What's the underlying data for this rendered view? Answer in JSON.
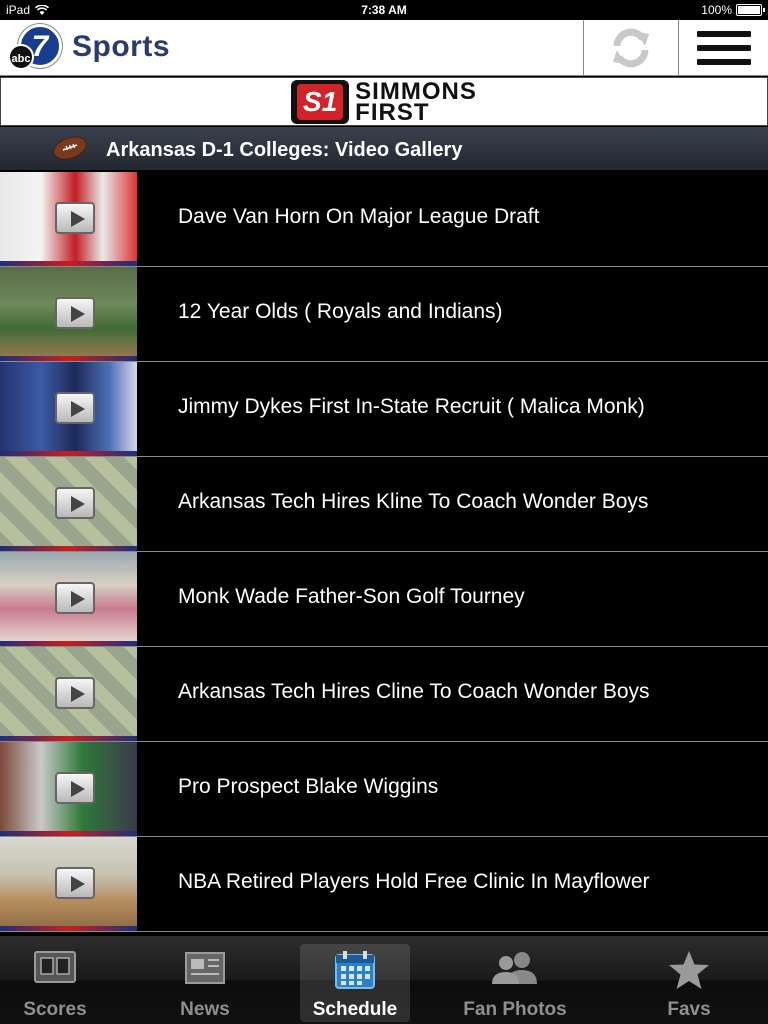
{
  "status_bar": {
    "device": "iPad",
    "time": "7:38 AM",
    "battery": "100%",
    "battery_level": 1.0
  },
  "header": {
    "logo_number": "7",
    "logo_network": "abc",
    "title": "Sports",
    "refresh_icon": "refresh-icon",
    "menu_icon": "hamburger-menu-icon"
  },
  "sponsor": {
    "mark": "S1",
    "line1": "SIMMONS",
    "line2": "FIRST"
  },
  "section": {
    "icon": "football-icon",
    "title": "Arkansas D-1 Colleges:  Video Gallery"
  },
  "videos": [
    {
      "title": "Dave Van Horn On Major League Draft",
      "scene": "press"
    },
    {
      "title": "12 Year Olds  ( Royals and Indians)",
      "scene": "field"
    },
    {
      "title": "Jimmy Dykes First In-State Recruit ( Malica Monk)",
      "scene": "gym-blue"
    },
    {
      "title": "Arkansas Tech Hires Kline To Coach Wonder Boys",
      "scene": "tech"
    },
    {
      "title": "Monk Wade Father-Son Golf Tourney",
      "scene": "golf"
    },
    {
      "title": "Arkansas Tech Hires Cline To Coach Wonder Boys",
      "scene": "tech"
    },
    {
      "title": "Pro Prospect  Blake Wiggins",
      "scene": "cage"
    },
    {
      "title": "NBA Retired Players Hold Free Clinic In Mayflower",
      "scene": "court"
    }
  ],
  "tabs": [
    {
      "label": "Scores",
      "icon": "scoreboard-icon",
      "active": false
    },
    {
      "label": "News",
      "icon": "newspaper-icon",
      "active": false
    },
    {
      "label": "Schedule",
      "icon": "calendar-icon",
      "active": true
    },
    {
      "label": "Fan Photos",
      "icon": "people-icon",
      "active": false
    },
    {
      "label": "Favs",
      "icon": "star-icon",
      "active": false
    }
  ],
  "colors": {
    "title_blue": "#2a3b6e",
    "sponsor_red": "#d2232a",
    "active_tab_icon": "#4aa3e8"
  }
}
